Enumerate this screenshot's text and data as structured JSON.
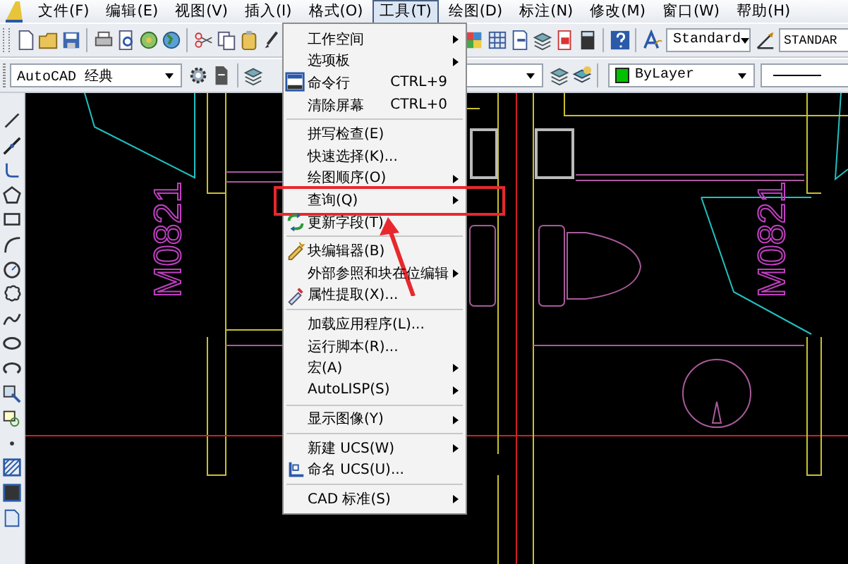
{
  "menubar": {
    "items": [
      {
        "label": "文件(F)",
        "selected": false
      },
      {
        "label": "编辑(E)",
        "selected": false
      },
      {
        "label": "视图(V)",
        "selected": false
      },
      {
        "label": "插入(I)",
        "selected": false
      },
      {
        "label": "格式(O)",
        "selected": false
      },
      {
        "label": "工具(T)",
        "selected": true
      },
      {
        "label": "绘图(D)",
        "selected": false
      },
      {
        "label": "标注(N)",
        "selected": false
      },
      {
        "label": "修改(M)",
        "selected": false
      },
      {
        "label": "窗口(W)",
        "selected": false
      },
      {
        "label": "帮助(H)",
        "selected": false
      }
    ]
  },
  "toolbar_1": {
    "text_style": "Standard",
    "dimension_style": "STANDAR"
  },
  "toolbar_2": {
    "workspace": "AutoCAD 经典",
    "color_control": "ByLayer"
  },
  "tools_menu": {
    "items": [
      {
        "kind": "item",
        "label": "工作空间",
        "submenu": true,
        "callout": false
      },
      {
        "kind": "item",
        "label": "选项板",
        "submenu": true,
        "callout": false
      },
      {
        "kind": "item",
        "label": "命令行",
        "shortcut": "CTRL+9",
        "submenu": false,
        "callout": false
      },
      {
        "kind": "item",
        "label": "清除屏幕",
        "shortcut": "CTRL+0",
        "submenu": false,
        "callout": false
      },
      {
        "kind": "separator"
      },
      {
        "kind": "item",
        "label": "拼写检查(E)",
        "submenu": false,
        "callout": false
      },
      {
        "kind": "item",
        "label": "快速选择(K)...",
        "submenu": false,
        "callout": false
      },
      {
        "kind": "item",
        "label": "绘图顺序(O)",
        "submenu": true,
        "callout": false
      },
      {
        "kind": "item",
        "label": "查询(Q)",
        "submenu": true,
        "callout": true
      },
      {
        "kind": "item",
        "label": "更新字段(T)",
        "submenu": false,
        "callout": false
      },
      {
        "kind": "separator"
      },
      {
        "kind": "item",
        "label": "块编辑器(B)",
        "submenu": false,
        "callout": false
      },
      {
        "kind": "item",
        "label": "外部参照和块在位编辑",
        "submenu": true,
        "callout": false
      },
      {
        "kind": "item",
        "label": "属性提取(X)...",
        "submenu": false,
        "callout": false
      },
      {
        "kind": "separator"
      },
      {
        "kind": "item",
        "label": "加载应用程序(L)...",
        "submenu": false,
        "callout": false
      },
      {
        "kind": "item",
        "label": "运行脚本(R)...",
        "submenu": false,
        "callout": false
      },
      {
        "kind": "item",
        "label": "宏(A)",
        "submenu": true,
        "callout": false
      },
      {
        "kind": "item",
        "label": "AutoLISP(S)",
        "submenu": true,
        "callout": false
      },
      {
        "kind": "separator"
      },
      {
        "kind": "item",
        "label": "显示图像(Y)",
        "submenu": true,
        "callout": false
      },
      {
        "kind": "separator"
      },
      {
        "kind": "item",
        "label": "新建 UCS(W)",
        "submenu": true,
        "callout": false
      },
      {
        "kind": "item",
        "label": "命名 UCS(U)...",
        "submenu": false,
        "callout": false
      },
      {
        "kind": "separator"
      },
      {
        "kind": "item",
        "label": "CAD 标准(S)",
        "submenu": true,
        "callout": false
      }
    ]
  },
  "drawing": {
    "labels": [
      "M0821",
      "M0821"
    ]
  }
}
